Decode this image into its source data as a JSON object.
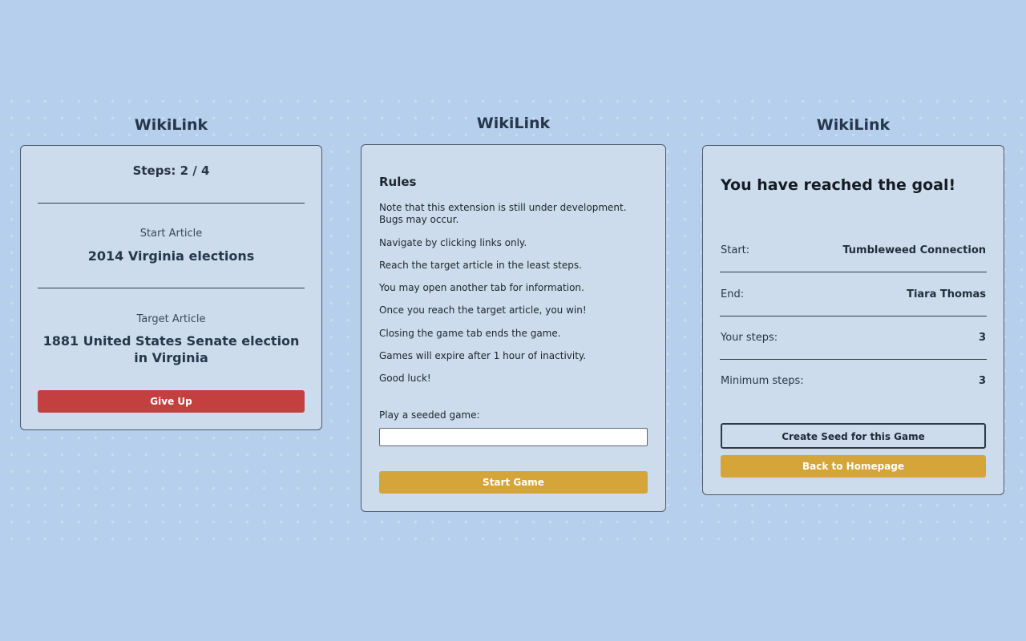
{
  "colors": {
    "background": "#b5cfec",
    "card": "#ccdcec",
    "danger": "#c44040",
    "accent": "#d5a53a"
  },
  "game_panel": {
    "title": "WikiLink",
    "steps": "Steps: 2 / 4",
    "start_label": "Start Article",
    "start_article": "2014 Virginia elections",
    "target_label": "Target Article",
    "target_article": "1881 United States Senate election in Virginia",
    "give_up_label": "Give Up"
  },
  "rules_panel": {
    "title": "WikiLink",
    "heading": "Rules",
    "rules": [
      "Note that this extension is still under development. Bugs may occur.",
      "Navigate by clicking links only.",
      "Reach the target article in the least steps.",
      "You may open another tab for information.",
      "Once you reach the target article, you win!",
      "Closing the game tab ends the game.",
      "Games will expire after 1 hour of inactivity.",
      "Good luck!"
    ],
    "seed_label": "Play a seeded game:",
    "seed_value": "",
    "start_button": "Start Game"
  },
  "result_panel": {
    "title": "WikiLink",
    "heading": "You have reached the goal!",
    "rows": [
      {
        "label": "Start:",
        "value": "Tumbleweed Connection"
      },
      {
        "label": "End:",
        "value": "Tiara Thomas"
      },
      {
        "label": "Your steps:",
        "value": "3"
      },
      {
        "label": "Minimum steps:",
        "value": "3"
      }
    ],
    "seed_button": "Create Seed for this Game",
    "home_button": "Back to Homepage"
  }
}
